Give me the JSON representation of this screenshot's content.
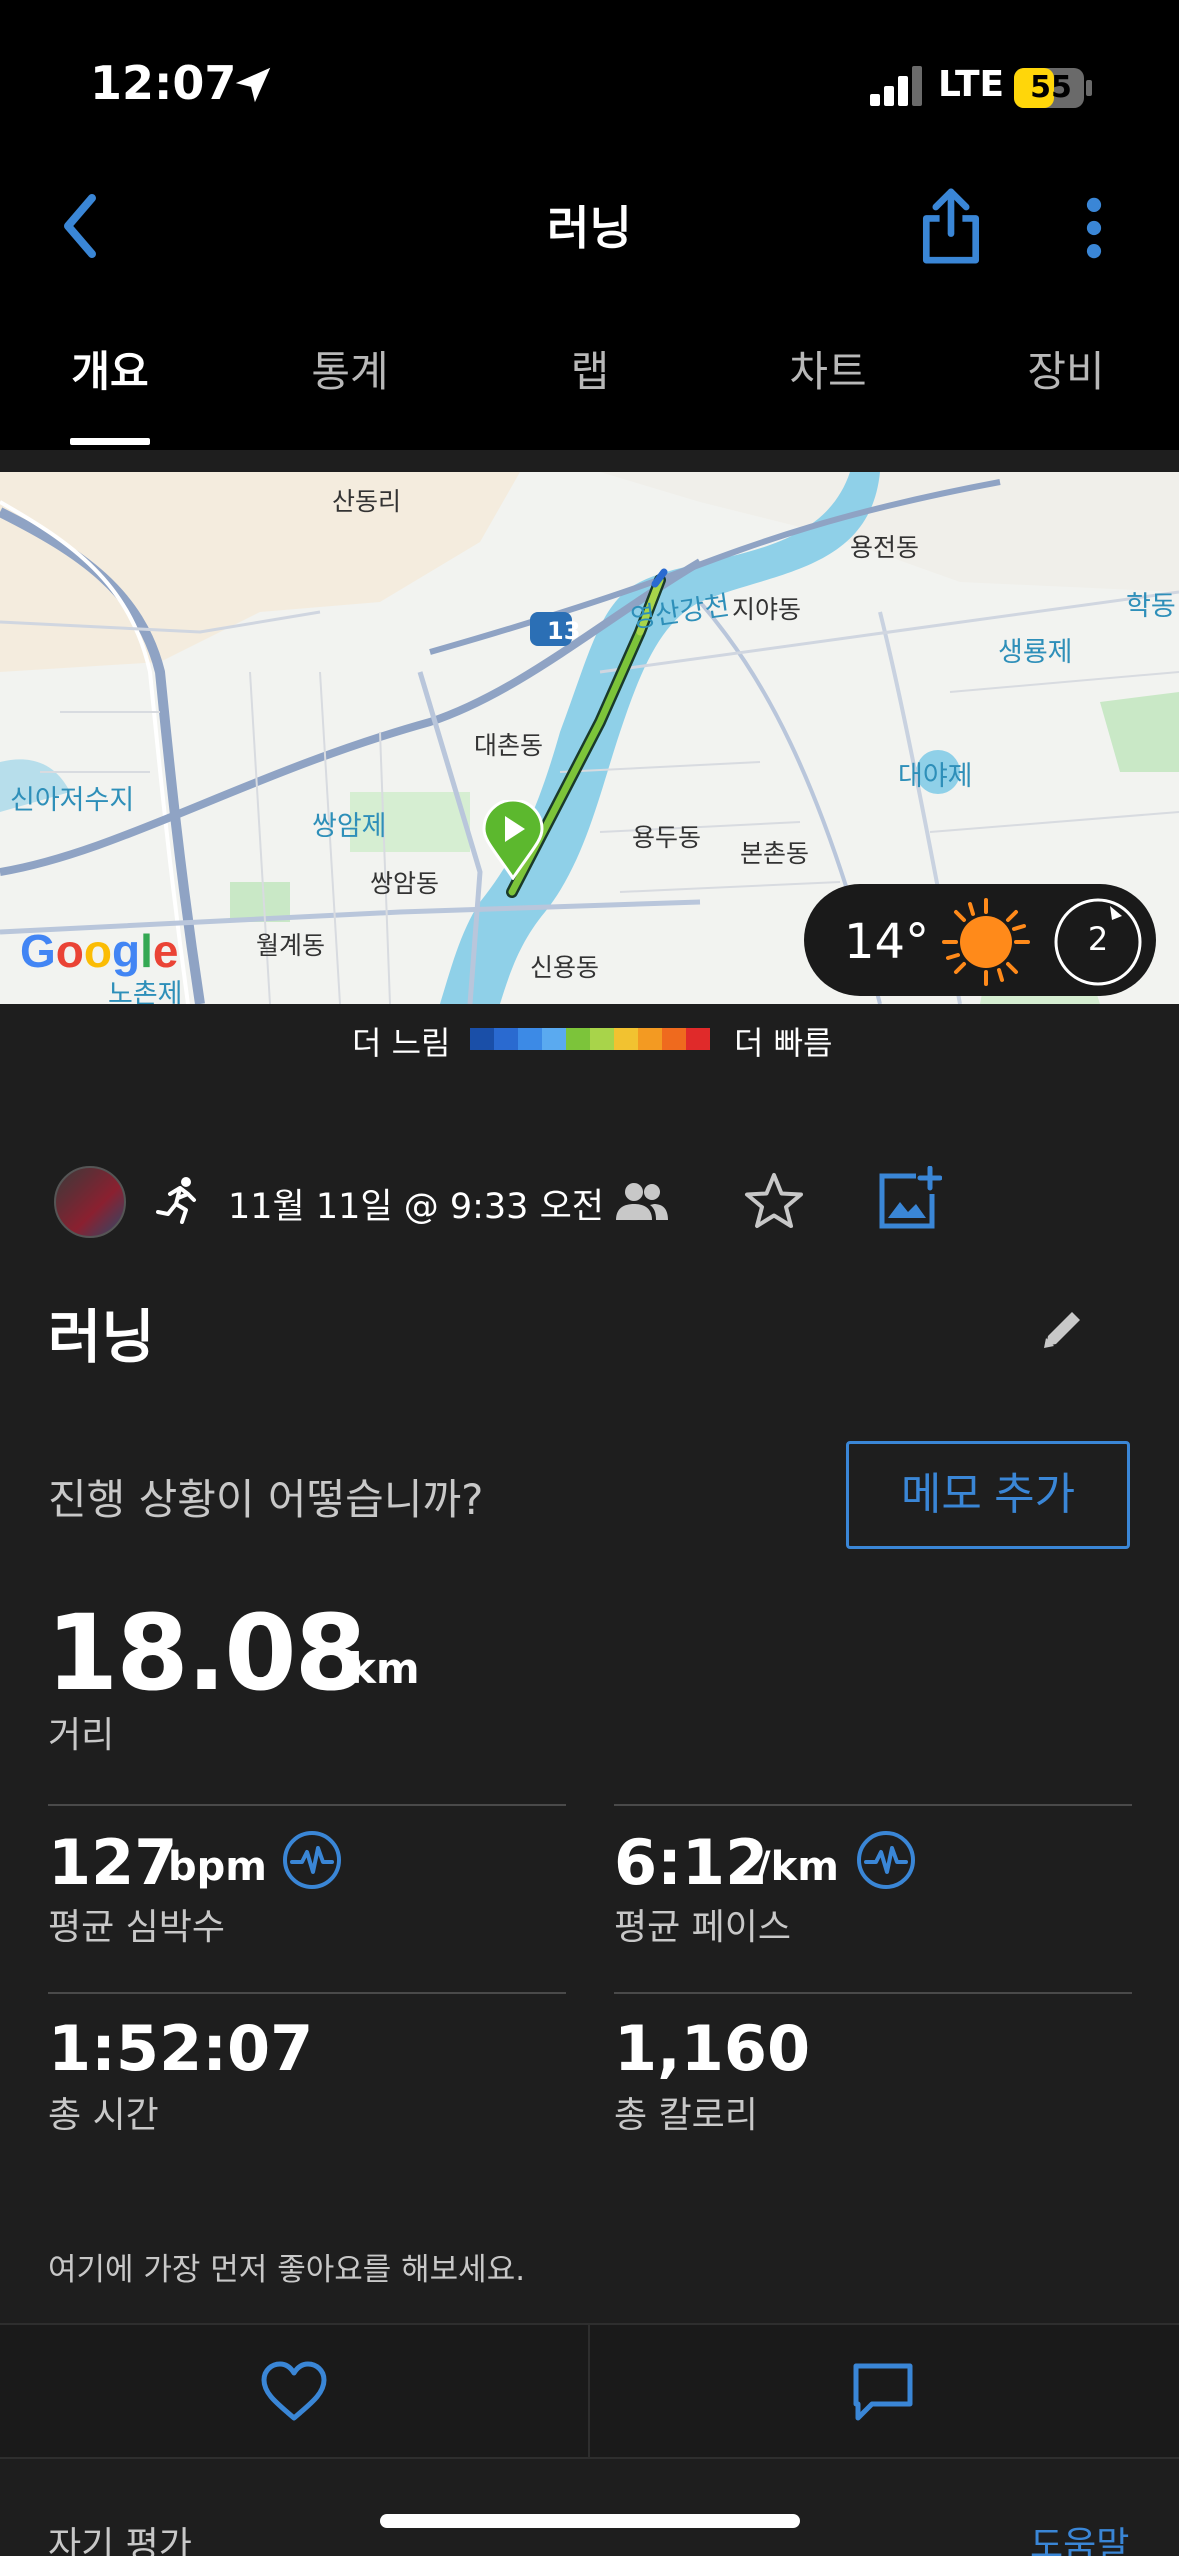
{
  "status_bar": {
    "time": "12:07",
    "network": "LTE",
    "battery": "55"
  },
  "header": {
    "title": "러닝"
  },
  "tabs": [
    {
      "label": "개요",
      "active": true
    },
    {
      "label": "통계",
      "active": false
    },
    {
      "label": "랩",
      "active": false
    },
    {
      "label": "차트",
      "active": false
    },
    {
      "label": "장비",
      "active": false
    }
  ],
  "map": {
    "place_labels": [
      "산동리",
      "용전동",
      "학동",
      "지야동",
      "생룡제",
      "대촌동",
      "대야제",
      "신아저수지",
      "쌍암제",
      "용두동",
      "본촌동",
      "쌍암동",
      "월계동",
      "신용동",
      "노촌제",
      "영산강천"
    ],
    "road_number": "13",
    "attribution": "Google",
    "weather": {
      "temperature": "14°",
      "wind": "2"
    }
  },
  "legend": {
    "slow_label": "더 느림",
    "fast_label": "더 빠름"
  },
  "activity": {
    "date": "11월 11일 @ 9:33 오전",
    "name": "러닝",
    "question": "진행 상황이 어떻습니까?",
    "memo_button": "메모 추가"
  },
  "stats": {
    "distance": {
      "value": "18.08",
      "unit": "km",
      "label": "거리"
    },
    "heart_rate": {
      "value": "127",
      "unit": "bpm",
      "label": "평균 심박수"
    },
    "pace": {
      "value": "6:12",
      "unit": "/km",
      "label": "평균 페이스"
    },
    "time": {
      "value": "1:52:07",
      "label": "총 시간"
    },
    "calories": {
      "value": "1,160",
      "label": "총 칼로리"
    }
  },
  "social": {
    "like_prompt": "여기에 가장 먼저 좋아요를 해보세요."
  },
  "footer": {
    "self_evaluation": "자기 평가",
    "help": "도움말"
  },
  "colors": {
    "accent": "#3a86d6",
    "background": "#1e1e1e",
    "route": "#7cc43a",
    "start_marker": "#5cb82e",
    "sun": "#ff8a1a"
  }
}
